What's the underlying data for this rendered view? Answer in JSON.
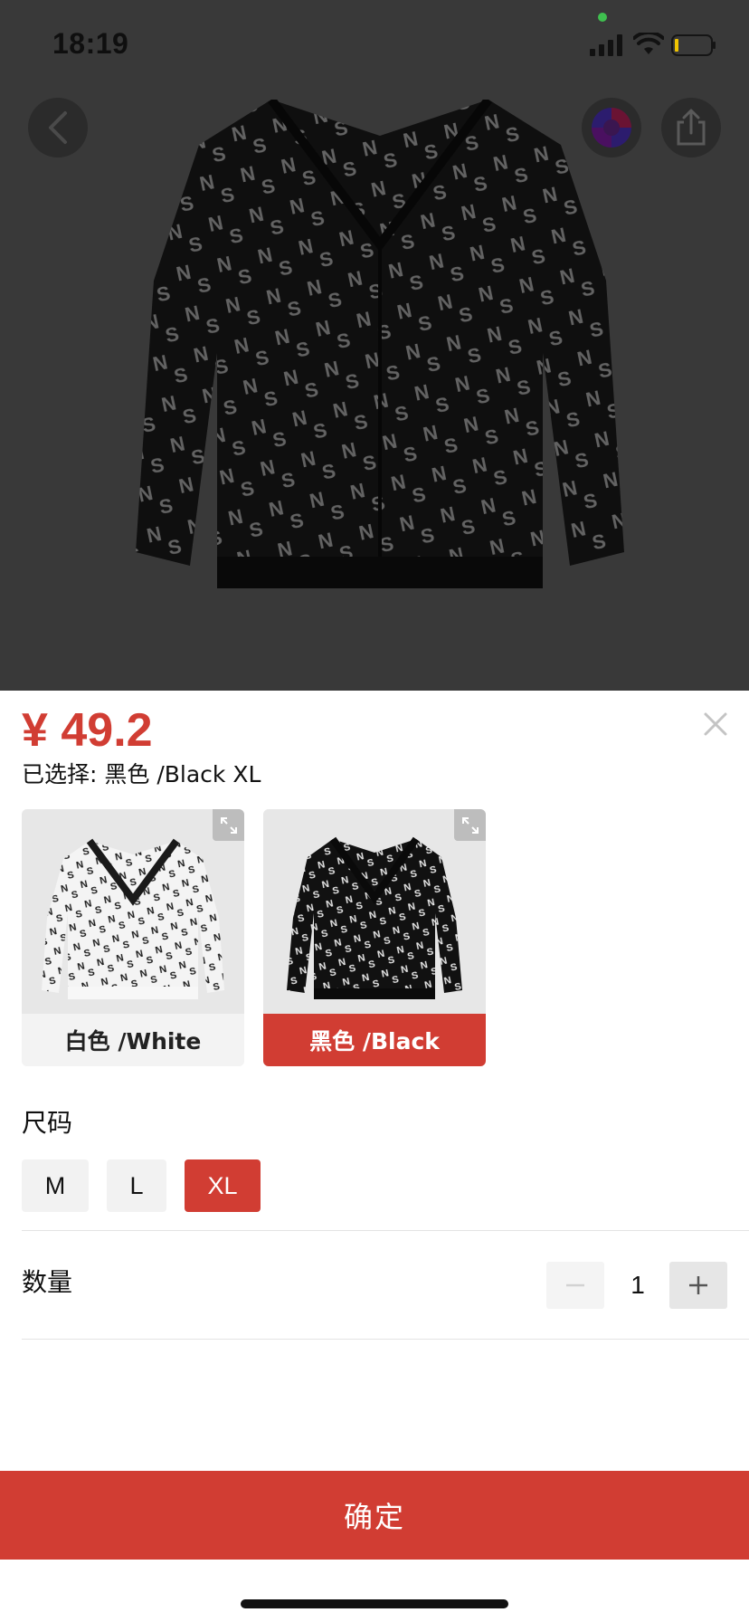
{
  "status_bar": {
    "time": "18:19"
  },
  "colors": {
    "accent": "#d13d33",
    "sheet_bg": "#ffffff",
    "overlay_bg": "#3d3d3d",
    "chip_bg": "#f2f2f2"
  },
  "icons": {
    "back": "chevron-left-icon",
    "color_theme": "color-circle-icon",
    "share": "share-icon",
    "close": "close-icon",
    "expand": "expand-icon",
    "minus": "minus-icon",
    "plus": "plus-icon"
  },
  "sheet": {
    "price": "¥ 49.2",
    "selected_text": "已选择: 黑色 /Black XL",
    "colors": [
      {
        "label": "白色 /White",
        "selected": false
      },
      {
        "label": "黑色 /Black",
        "selected": true
      }
    ],
    "size_title": "尺码",
    "sizes": [
      {
        "label": "M",
        "selected": false
      },
      {
        "label": "L",
        "selected": false
      },
      {
        "label": "XL",
        "selected": true
      }
    ],
    "quantity_title": "数量",
    "quantity": "1",
    "confirm_label": "确定"
  }
}
